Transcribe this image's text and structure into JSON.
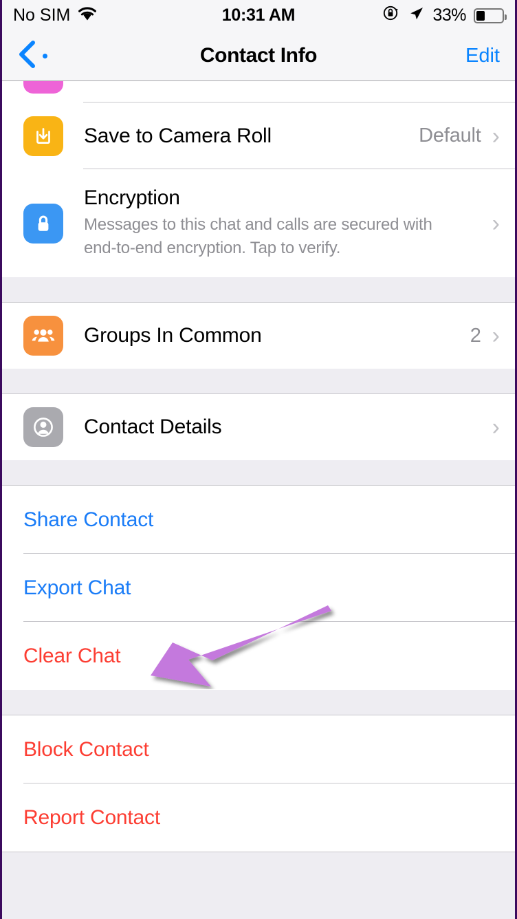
{
  "status_bar": {
    "carrier": "No SIM",
    "wifi_icon": "wifi-icon",
    "time": "10:31 AM",
    "rotation_lock_icon": "rotation-lock-icon",
    "location_icon": "location-arrow-icon",
    "battery_percent": "33%",
    "battery_level": 33
  },
  "nav_bar": {
    "back_icon": "chevron-left-icon",
    "back_label": ".",
    "title": "Contact Info",
    "edit_label": "Edit"
  },
  "colors": {
    "accent_blue": "#1a7cf7",
    "destructive_red": "#fc3d32",
    "annotation_purple": "#c479dd",
    "icon_amber": "#f9b415",
    "icon_blue": "#3b97f3",
    "icon_orange": "#f7913e",
    "icon_gray": "#aaaaaf",
    "icon_pink": "#ee64d7",
    "group_background": "#eeedf2",
    "secondary_text": "#8e8e93"
  },
  "sections": [
    {
      "name": "chat-settings",
      "rows": [
        {
          "name": "save-to-camera-roll",
          "icon": "download-to-tray-icon",
          "title": "Save to Camera Roll",
          "value": "Default",
          "chevron": "›"
        },
        {
          "name": "encryption",
          "icon": "lock-icon",
          "title": "Encryption",
          "subtitle": "Messages to this chat and calls are secured with end-to-end encryption. Tap to verify.",
          "chevron": "›"
        }
      ]
    },
    {
      "name": "groups",
      "rows": [
        {
          "name": "groups-in-common",
          "icon": "people-group-icon",
          "title": "Groups In Common",
          "value": "2",
          "chevron": "›"
        }
      ]
    },
    {
      "name": "contact-details",
      "rows": [
        {
          "name": "contact-details",
          "icon": "person-circle-icon",
          "title": "Contact Details",
          "chevron": "›"
        }
      ]
    }
  ],
  "actions_primary": [
    {
      "name": "share-contact",
      "label": "Share Contact",
      "style": "blue"
    },
    {
      "name": "export-chat",
      "label": "Export Chat",
      "style": "blue"
    },
    {
      "name": "clear-chat",
      "label": "Clear Chat",
      "style": "red"
    }
  ],
  "actions_secondary": [
    {
      "name": "block-contact",
      "label": "Block Contact",
      "style": "red"
    },
    {
      "name": "report-contact",
      "label": "Report Contact",
      "style": "red"
    }
  ],
  "annotation": {
    "name": "purple-arrow-annotation",
    "points_to": "clear-chat",
    "color": "#c479dd"
  }
}
